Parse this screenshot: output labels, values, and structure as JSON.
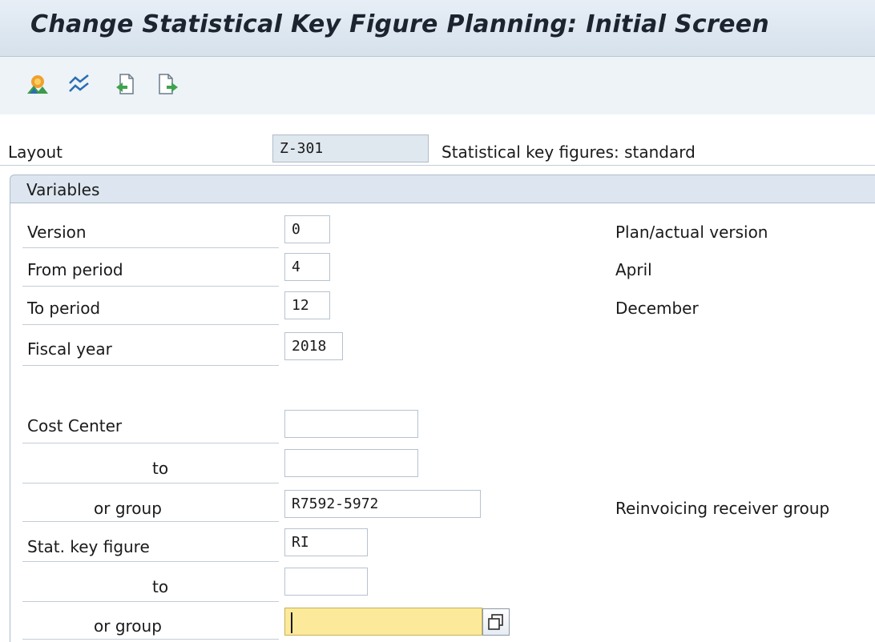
{
  "title": "Change Statistical Key Figure Planning: Initial Screen",
  "toolbar": {
    "icons": [
      "planner-profile-icon",
      "graphic-icon",
      "previous-layout-icon",
      "next-layout-icon"
    ]
  },
  "layout": {
    "label": "Layout",
    "value": "Z-301",
    "description": "Statistical key figures: standard"
  },
  "variables": {
    "title": "Variables",
    "version": {
      "label": "Version",
      "value": "0",
      "description": "Plan/actual version"
    },
    "from_period": {
      "label": "From period",
      "value": "4",
      "description": "April"
    },
    "to_period": {
      "label": "To period",
      "value": "12",
      "description": "December"
    },
    "fiscal_year": {
      "label": "Fiscal year",
      "value": "2018"
    },
    "cost_center": {
      "label": "Cost Center",
      "value": "",
      "to_label": "to",
      "to_value": "",
      "group_label": "or group",
      "group_value": "R7592-5972",
      "group_description": "Reinvoicing receiver group"
    },
    "stat_key_figure": {
      "label": "Stat. key figure",
      "value": "RI",
      "to_label": "to",
      "to_value": "",
      "group_label": "or group",
      "group_value": ""
    }
  },
  "colors": {
    "active_field": "#fce99a",
    "readonly_field": "#dfe7ef",
    "title_bar": "#dbe4ee"
  }
}
